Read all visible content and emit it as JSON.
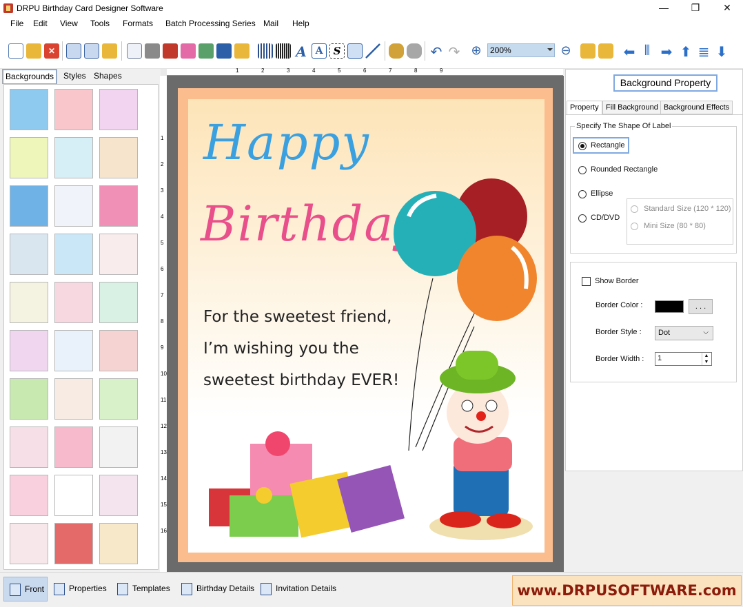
{
  "window": {
    "title": "DRPU Birthday Card Designer Software",
    "minimize": "—",
    "maximize": "❐",
    "close": "✕"
  },
  "menu": [
    "File",
    "Edit",
    "View",
    "Tools",
    "Formats",
    "Batch Processing Series",
    "Mail",
    "Help"
  ],
  "toolbar": {
    "zoom": "200%"
  },
  "left_tabs": [
    "Backgrounds",
    "Styles",
    "Shapes"
  ],
  "card": {
    "line1": "Happy",
    "line2": "Birthday",
    "message": [
      "For the sweetest friend,",
      "I’m wishing you the",
      "sweetest birthday EVER!"
    ]
  },
  "ruler": {
    "h": [
      "1",
      "2",
      "3",
      "4",
      "5",
      "6",
      "7",
      "8",
      "9"
    ],
    "v": [
      "1",
      "2",
      "3",
      "4",
      "5",
      "6",
      "7",
      "8",
      "9",
      "10",
      "11",
      "12",
      "13",
      "14",
      "15",
      "16"
    ]
  },
  "right": {
    "header": "Background Property",
    "tabs": [
      "Property",
      "Fill Background",
      "Background Effects"
    ],
    "shape_legend": "Specify The Shape Of Label",
    "shapes": [
      "Rectangle",
      "Rounded Rectangle",
      "Ellipse",
      "CD/DVD"
    ],
    "selected_shape": "Rectangle",
    "cd_sizes": [
      "Standard Size (120 * 120)",
      "Mini Size (80 * 80)"
    ],
    "show_border": "Show Border",
    "border_color_label": "Border Color :",
    "border_color": "#000000",
    "border_color_btn": ". . .",
    "border_style_label": "Border Style :",
    "border_style": "Dot",
    "border_width_label": "Border Width :",
    "border_width": "1"
  },
  "bottom_tabs": [
    "Front",
    "Properties",
    "Templates",
    "Birthday Details",
    "Invitation Details"
  ],
  "brand": "www.DRPUSOFTWARE.com",
  "colors": {
    "accent": "#7fa8e0",
    "card_border": "#fbbd8e",
    "brand_text": "#8b1b0a"
  }
}
